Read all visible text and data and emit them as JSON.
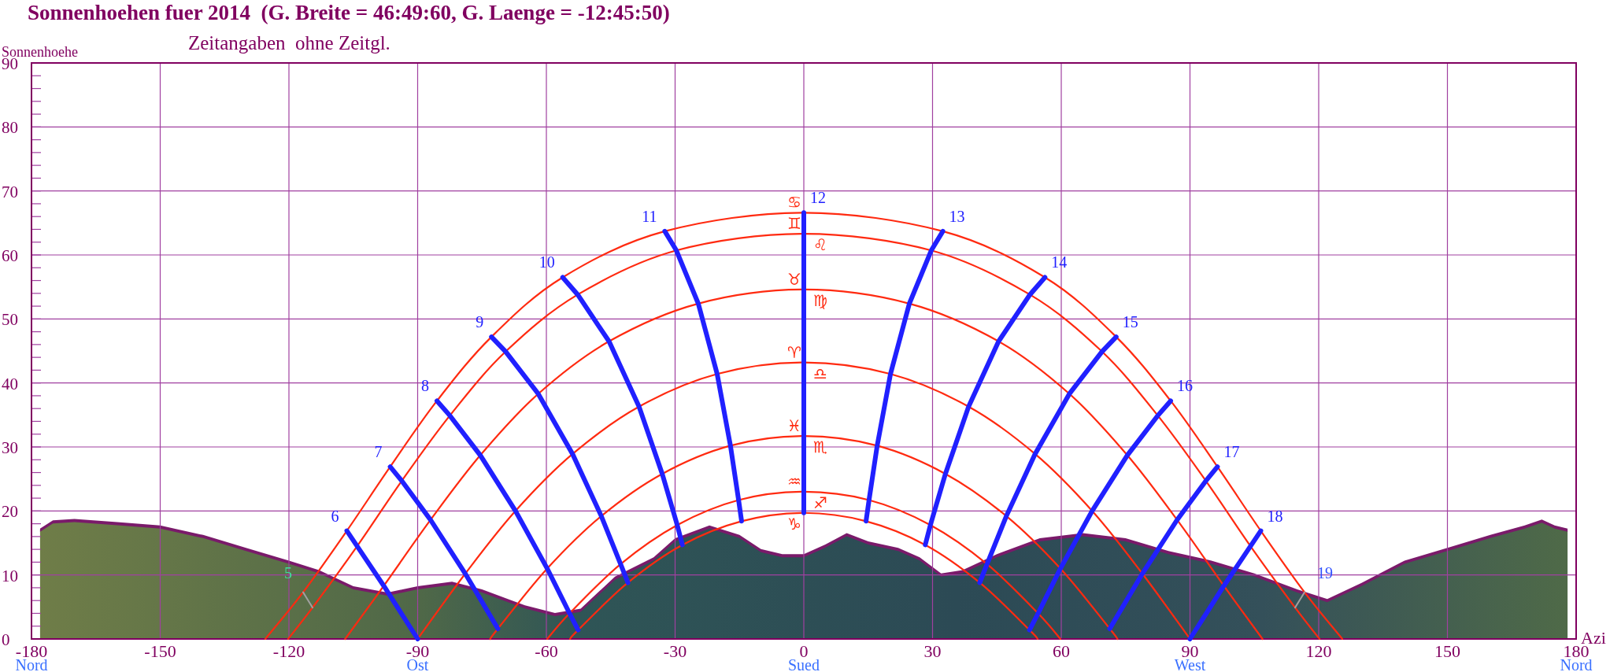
{
  "chart": {
    "subtitle": "Zeitangaben  ohne Zeitgl.",
    "chart_data": {
      "type": "line",
      "title": "Sonnenhoehen fuer 2014  (G. Breite = 46:49:60, G. Laenge = -12:45:50)",
      "xlabel": "Azi",
      "ylabel": "Sonnenhoehe",
      "xlim": [
        -180,
        180
      ],
      "ylim": [
        0,
        90
      ],
      "xticks": [
        -180,
        -150,
        -120,
        -90,
        -60,
        -30,
        0,
        30,
        60,
        90,
        120,
        150,
        180
      ],
      "yticks": [
        0,
        10,
        20,
        30,
        40,
        50,
        60,
        70,
        80,
        90
      ],
      "series": [
        {
          "color": "#ff2a10",
          "x": [
            -125.5,
            -116.7,
            -106.5,
            -96.4,
            -85.5,
            -72.8,
            -56.2,
            -32.4,
            0,
            32.4,
            56.2,
            72.8,
            85.5,
            96.4,
            106.5,
            116.7,
            125.5
          ],
          "values": [
            0,
            7.3,
            16.9,
            26.9,
            37.2,
            47.2,
            56.5,
            63.7,
            66.6,
            63.7,
            56.5,
            47.2,
            37.2,
            26.9,
            16.9,
            7.3,
            0
          ]
        },
        {
          "color": "#ff2a10",
          "x": [
            -120.2,
            -114.5,
            -104.1,
            -93.7,
            -82.5,
            -69.5,
            -52.7,
            -29.7,
            0,
            29.7,
            52.7,
            69.5,
            82.5,
            93.7,
            104.1,
            114.5,
            120.2
          ],
          "values": [
            0,
            4.9,
            14.5,
            24.7,
            34.9,
            44.9,
            53.8,
            60.7,
            63.3,
            60.7,
            53.8,
            44.9,
            34.9,
            24.7,
            14.5,
            4.9,
            0
          ]
        },
        {
          "color": "#ff2a10",
          "x": [
            -106.9,
            -97.9,
            -87.0,
            -75.4,
            -61.9,
            -45.4,
            -24.6,
            0,
            24.6,
            45.4,
            61.9,
            75.4,
            87.0,
            97.9,
            106.9
          ],
          "values": [
            0,
            8.3,
            18.6,
            28.7,
            38.3,
            46.5,
            52.4,
            54.6,
            52.4,
            46.5,
            38.3,
            28.7,
            18.6,
            8.3,
            0
          ]
        },
        {
          "color": "#ff2a10",
          "x": [
            -90,
            -78.9,
            -67.2,
            -53.9,
            -38.4,
            -20.2,
            0,
            20.2,
            38.4,
            53.9,
            67.2,
            78.9,
            90
          ],
          "values": [
            0,
            10.2,
            20.0,
            28.9,
            36.3,
            41.4,
            43.2,
            41.4,
            36.3,
            28.9,
            20.0,
            10.2,
            0
          ]
        },
        {
          "color": "#ff2a10",
          "x": [
            -73.1,
            -71.3,
            -59.8,
            -47.2,
            -33.0,
            -17.1,
            0,
            17.1,
            33.0,
            47.2,
            59.8,
            71.3,
            73.1
          ],
          "values": [
            0,
            1.6,
            11.0,
            19.2,
            25.8,
            30.2,
            31.7,
            30.2,
            25.8,
            19.2,
            11.0,
            1.6,
            0
          ]
        },
        {
          "color": "#ff2a10",
          "x": [
            -59.8,
            -54.6,
            -42.7,
            -29.5,
            -15.2,
            0,
            15.2,
            29.5,
            42.7,
            54.6,
            59.8
          ],
          "values": [
            0,
            4.0,
            11.7,
            17.8,
            21.7,
            23.0,
            21.7,
            17.8,
            11.7,
            4.0,
            0
          ]
        },
        {
          "color": "#ff2a10",
          "x": [
            -54.5,
            -52.6,
            -41.0,
            -28.3,
            -14.5,
            0,
            14.5,
            28.3,
            41.0,
            52.6,
            54.5
          ],
          "values": [
            0,
            1.4,
            8.8,
            14.7,
            18.4,
            19.7,
            18.4,
            14.7,
            8.8,
            1.4,
            0
          ]
        },
        {
          "name": "5",
          "color": "#a0a0a0",
          "x": [
            -116.7,
            -114.5
          ],
          "values": [
            7.3,
            4.9
          ]
        },
        {
          "name": "6",
          "color": "#2020ff",
          "x": [
            -106.5,
            -104.1,
            -97.9,
            -90
          ],
          "values": [
            16.9,
            14.5,
            8.3,
            0
          ]
        },
        {
          "name": "7",
          "color": "#2020ff",
          "x": [
            -96.4,
            -93.7,
            -87.0,
            -78.9,
            -71.3
          ],
          "values": [
            26.9,
            24.7,
            18.6,
            10.2,
            1.6
          ]
        },
        {
          "name": "8",
          "color": "#2020ff",
          "x": [
            -85.5,
            -82.5,
            -75.4,
            -67.2,
            -59.8,
            -54.6,
            -52.6
          ],
          "values": [
            37.2,
            34.9,
            28.7,
            20.0,
            11.0,
            4.0,
            1.4
          ]
        },
        {
          "name": "9",
          "color": "#2020ff",
          "x": [
            -72.8,
            -69.5,
            -61.9,
            -53.9,
            -47.2,
            -42.7,
            -41.0
          ],
          "values": [
            47.2,
            44.9,
            38.3,
            28.9,
            19.2,
            11.7,
            8.8
          ]
        },
        {
          "name": "10",
          "color": "#2020ff",
          "x": [
            -56.2,
            -52.7,
            -45.4,
            -38.4,
            -33.0,
            -29.5,
            -28.3
          ],
          "values": [
            56.5,
            53.8,
            46.5,
            36.3,
            25.8,
            17.8,
            14.7
          ]
        },
        {
          "name": "11",
          "color": "#2020ff",
          "x": [
            -32.4,
            -29.7,
            -24.6,
            -20.2,
            -17.1,
            -15.2,
            -14.5
          ],
          "values": [
            63.7,
            60.7,
            52.4,
            41.4,
            30.2,
            21.7,
            18.4
          ]
        },
        {
          "name": "12",
          "color": "#2020ff",
          "x": [
            0,
            0,
            0,
            0,
            0,
            0,
            0
          ],
          "values": [
            66.6,
            63.3,
            54.6,
            43.2,
            31.7,
            23.0,
            19.7
          ]
        },
        {
          "name": "13",
          "color": "#2020ff",
          "x": [
            32.4,
            29.7,
            24.6,
            20.2,
            17.1,
            15.2,
            14.5
          ],
          "values": [
            63.7,
            60.7,
            52.4,
            41.4,
            30.2,
            21.7,
            18.4
          ]
        },
        {
          "name": "14",
          "color": "#2020ff",
          "x": [
            56.2,
            52.7,
            45.4,
            38.4,
            33.0,
            29.5,
            28.3
          ],
          "values": [
            56.5,
            53.8,
            46.5,
            36.3,
            25.8,
            17.8,
            14.7
          ]
        },
        {
          "name": "15",
          "color": "#2020ff",
          "x": [
            72.8,
            69.5,
            61.9,
            53.9,
            47.2,
            42.7,
            41.0
          ],
          "values": [
            47.2,
            44.9,
            38.3,
            28.9,
            19.2,
            11.7,
            8.8
          ]
        },
        {
          "name": "16",
          "color": "#2020ff",
          "x": [
            85.5,
            82.5,
            75.4,
            67.2,
            59.8,
            54.6,
            52.6
          ],
          "values": [
            37.2,
            34.9,
            28.7,
            20.0,
            11.0,
            4.0,
            1.4
          ]
        },
        {
          "name": "17",
          "color": "#2020ff",
          "x": [
            96.4,
            93.7,
            87.0,
            78.9,
            71.3
          ],
          "values": [
            26.9,
            24.7,
            18.6,
            10.2,
            1.6
          ]
        },
        {
          "name": "18",
          "color": "#2020ff",
          "x": [
            106.5,
            104.1,
            97.9,
            90
          ],
          "values": [
            16.9,
            14.5,
            8.3,
            0
          ]
        },
        {
          "name": "19",
          "color": "#a0a0a0",
          "x": [
            116.7,
            114.5
          ],
          "values": [
            7.3,
            4.9
          ]
        }
      ],
      "annotations": [
        "♋",
        "♊",
        "♌",
        "♉",
        "♍",
        "♈",
        "♎",
        "♓",
        "♏",
        "♒",
        "♐",
        "♑"
      ],
      "grid": true
    }
  },
  "compass_labels": [
    "Nord",
    "Ost",
    "Sued",
    "West",
    "Nord"
  ]
}
